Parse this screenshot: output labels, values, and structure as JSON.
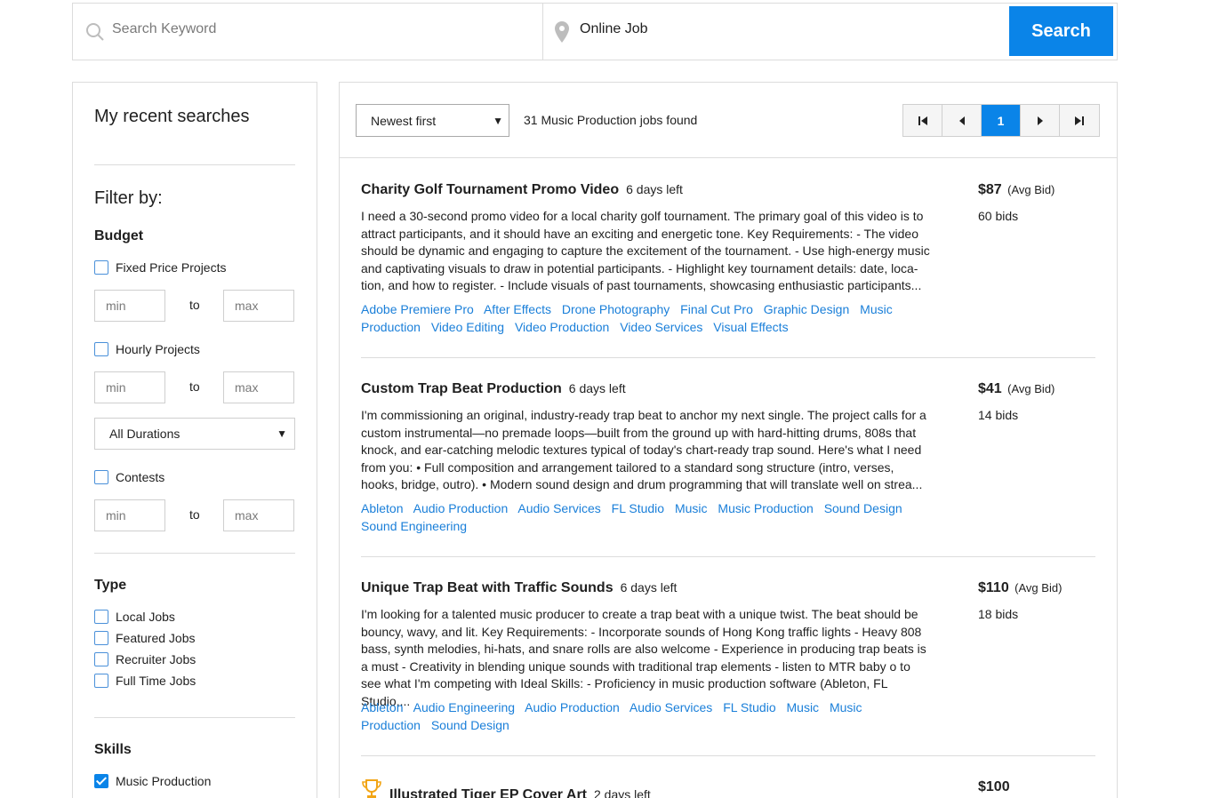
{
  "search": {
    "keyword_placeholder": "Search Keyword",
    "location_value": "Online Job",
    "button_label": "Search"
  },
  "sidebar": {
    "recent_title": "My recent searches",
    "filter_title": "Filter by:",
    "budget": {
      "heading": "Budget",
      "fixed_label": "Fixed Price Projects",
      "hourly_label": "Hourly Projects",
      "contests_label": "Contests",
      "min_placeholder": "min",
      "max_placeholder": "max",
      "to_label": "to",
      "duration_value": "All Durations"
    },
    "type": {
      "heading": "Type",
      "items": [
        "Local Jobs",
        "Featured Jobs",
        "Recruiter Jobs",
        "Full Time Jobs"
      ]
    },
    "skills": {
      "heading": "Skills",
      "items": [
        {
          "label": "Music Production",
          "checked": true
        }
      ]
    }
  },
  "toolbar": {
    "sort_value": "Newest first",
    "found_text": "31 Music Production jobs found",
    "current_page": "1"
  },
  "jobs": [
    {
      "title": "Charity Golf Tournament Promo Video",
      "time_left": "6 days left",
      "price": "$87",
      "price_note": "(Avg Bid)",
      "bids": "60 bids",
      "description": "I need a 30-second promo video for a local charity golf tournament. The primary goal of this video is to attract participants, and it should have an exciting and energetic tone. Key Requirements: - The video should be dynamic and engaging to capture the excitement of the tournament. - Use high-energy music and captivating visuals to draw in potential participants. - Highlight key tournament details: date, loca-tion, and how to register. - Include visuals of past tournaments, showcasing enthusiastic participants...",
      "tags": [
        "Adobe Premiere Pro",
        "After Effects",
        "Drone Photography",
        "Final Cut Pro",
        "Graphic Design",
        "Music Production",
        "Video Editing",
        "Video Production",
        "Video Services",
        "Visual Effects"
      ]
    },
    {
      "title": "Custom Trap Beat Production",
      "time_left": "6 days left",
      "price": "$41",
      "price_note": "(Avg Bid)",
      "bids": "14 bids",
      "description": "I'm commissioning an original, industry-ready trap beat to anchor my next single. The project calls for a custom instrumental—no premade loops—built from the ground up with hard-hitting drums, 808s that knock, and ear-catching melodic textures typical of today's chart-ready trap sound. Here's what I need from you: • Full composition and arrangement tailored to a standard song structure (intro, verses, hooks, bridge, outro). • Modern sound design and drum programming that will translate well on strea...",
      "tags": [
        "Ableton",
        "Audio Production",
        "Audio Services",
        "FL Studio",
        "Music",
        "Music Production",
        "Sound Design",
        "Sound Engineering"
      ]
    },
    {
      "title": "Unique Trap Beat with Traffic Sounds",
      "time_left": "6 days left",
      "price": "$110",
      "price_note": "(Avg Bid)",
      "bids": "18 bids",
      "description": "I'm looking for a talented music producer to create a trap beat with a unique twist. The beat should be bouncy, wavy, and lit. Key Requirements: - Incorporate sounds of Hong Kong traffic lights - Heavy 808 bass, synth melodies, hi-hats, and snare rolls are also welcome - Experience in producing trap beats is a must - Creativity in blending unique sounds with traditional trap elements - listen to MTR baby o to see what I'm competing with Ideal Skills: - Proficiency in music production software (Ableton, FL Studio,...",
      "tags": [
        "Ableton",
        "Audio Engineering",
        "Audio Production",
        "Audio Services",
        "FL Studio",
        "Music",
        "Music Production",
        "Sound Design"
      ]
    },
    {
      "title": "Illustrated Tiger EP Cover Art",
      "time_left": "2 days left",
      "price": "$100"
    }
  ]
}
